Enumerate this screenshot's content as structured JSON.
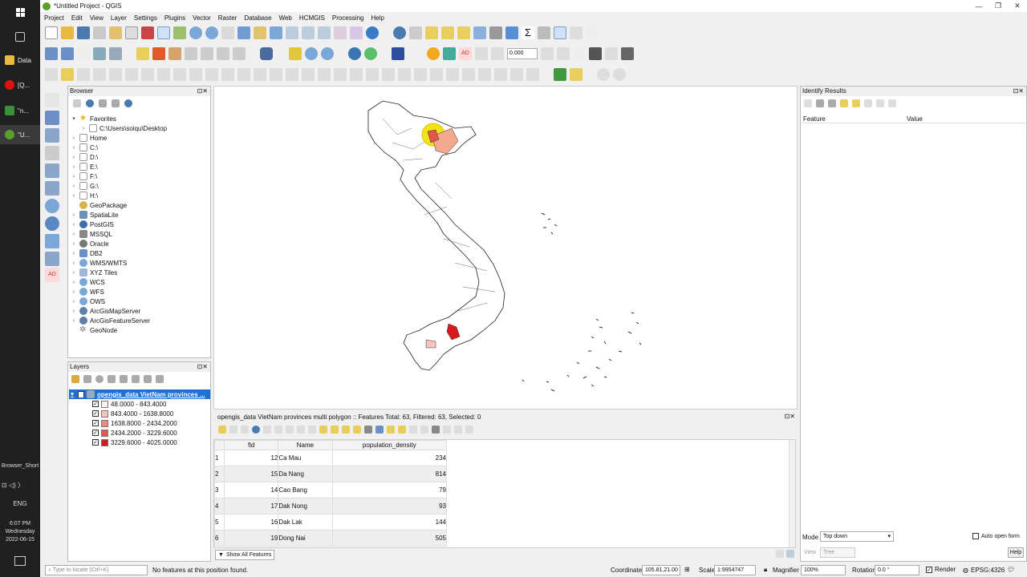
{
  "window": {
    "title": "*Untitled Project - QGIS"
  },
  "menu": [
    "Project",
    "Edit",
    "View",
    "Layer",
    "Settings",
    "Plugins",
    "Vector",
    "Raster",
    "Database",
    "Web",
    "HCMGIS",
    "Processing",
    "Help"
  ],
  "taskbar": {
    "items": [
      "Data",
      "[Q...",
      "\"n...",
      "\"U..."
    ],
    "shortcut": "Browser_Short",
    "lang": "ENG",
    "time": "6:07 PM",
    "day": "Wednesday",
    "date": "2022-06-15"
  },
  "browser": {
    "title": "Browser",
    "favorites": "Favorites",
    "desktop": "C:\\Users\\soiqu\\Desktop",
    "items": [
      "Home",
      "C:\\",
      "D:\\",
      "E:\\",
      "F:\\",
      "G:\\",
      "H:\\",
      "GeoPackage",
      "SpatiaLite",
      "PostGIS",
      "MSSQL",
      "Oracle",
      "DB2",
      "WMS/WMTS",
      "XYZ Tiles",
      "WCS",
      "WFS",
      "OWS",
      "ArcGisMapServer",
      "ArcGisFeatureServer",
      "GeoNode"
    ]
  },
  "layers": {
    "title": "Layers",
    "layer_name": "opengis_data VietNam provinces ...",
    "classes": [
      {
        "label": "48.0000 - 843.4000",
        "color": "#fdf0ee"
      },
      {
        "label": "843.4000 - 1638.8000",
        "color": "#f6c4bd"
      },
      {
        "label": "1638.8000 - 2434.2000",
        "color": "#ef8a80"
      },
      {
        "label": "2434.2000 - 3229.6000",
        "color": "#e4554a"
      },
      {
        "label": "3229.6000 - 4025.0000",
        "color": "#d7191c"
      }
    ]
  },
  "identify": {
    "title": "Identify Results",
    "col_feature": "Feature",
    "col_value": "Value",
    "mode_label": "Mode",
    "mode_value": "Top down",
    "auto_open": "Auto open form",
    "view_label": "View",
    "view_value": "Tree",
    "help": "Help"
  },
  "attr": {
    "title": "opengis_data VietNam provinces multi polygon :: Features Total: 63, Filtered: 63, Selected: 0",
    "headers": [
      "fid",
      "Name",
      "population_density"
    ],
    "rows": [
      {
        "n": "1",
        "fid": "12",
        "name": "Ca Mau",
        "pd": "234"
      },
      {
        "n": "2",
        "fid": "15",
        "name": "Da Nang",
        "pd": "814"
      },
      {
        "n": "3",
        "fid": "14",
        "name": "Cao Bang",
        "pd": "79"
      },
      {
        "n": "4",
        "fid": "17",
        "name": "Dak Nong",
        "pd": "93"
      },
      {
        "n": "5",
        "fid": "16",
        "name": "Dak Lak",
        "pd": "144"
      },
      {
        "n": "6",
        "fid": "19",
        "name": "Dong Nai",
        "pd": "505"
      }
    ],
    "show_all": "Show All Features"
  },
  "toolbar": {
    "value_field": "0.000"
  },
  "status": {
    "locate_placeholder": "Type to locate (Ctrl+K)",
    "message": "No features at this position found.",
    "coord_label": "Coordinate",
    "coord": "105.81,21.00",
    "scale_label": "Scale",
    "scale": "1:9954747",
    "magnifier_label": "Magnifier",
    "magnifier": "100%",
    "rotation_label": "Rotation",
    "rotation": "0.0 °",
    "render": "Render",
    "crs": "EPSG:4326"
  }
}
